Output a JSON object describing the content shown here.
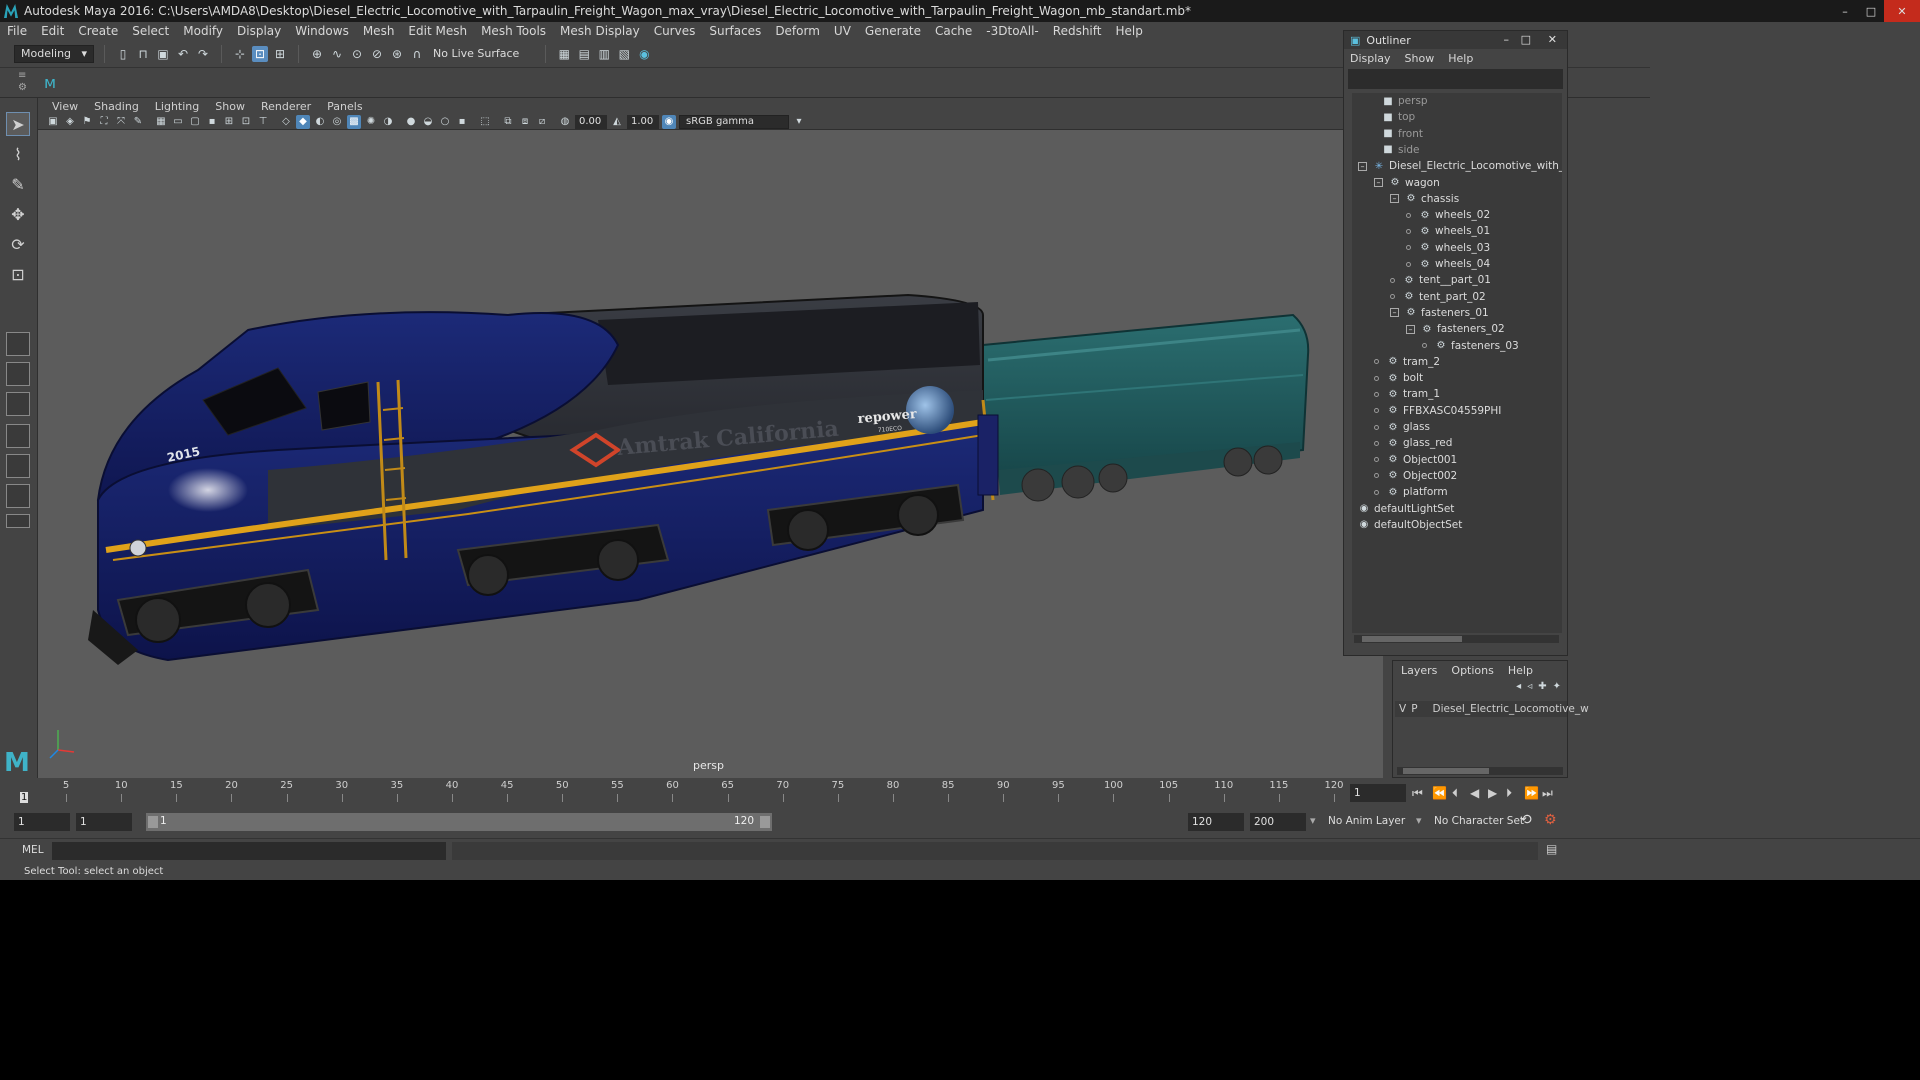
{
  "title_bar": {
    "title": "Autodesk Maya 2016: C:\\Users\\AMDA8\\Desktop\\Diesel_Electric_Locomotive_with_Tarpaulin_Freight_Wagon_max_vray\\Diesel_Electric_Locomotive_with_Tarpaulin_Freight_Wagon_mb_standart.mb*",
    "minimize": "–",
    "maximize": "□",
    "close": "✕"
  },
  "menubar": [
    "File",
    "Edit",
    "Create",
    "Select",
    "Modify",
    "Display",
    "Windows",
    "Mesh",
    "Edit Mesh",
    "Mesh Tools",
    "Mesh Display",
    "Curves",
    "Surfaces",
    "Deform",
    "UV",
    "Generate",
    "Cache",
    "-3DtoAll-",
    "Redshift",
    "Help"
  ],
  "toolbar": {
    "mode": "Modeling",
    "live_surface": "No Live Surface"
  },
  "viewport": {
    "menu": [
      "View",
      "Shading",
      "Lighting",
      "Show",
      "Renderer",
      "Panels"
    ],
    "exposure": "0.00",
    "gamma": "1.00",
    "color_space": "sRGB gamma",
    "camera_label": "persp",
    "loco_number": "2015",
    "loco_brand": "Amtrak California",
    "loco_badge": "repower",
    "loco_badge_sub": "710ECO"
  },
  "outliner": {
    "title": "Outliner",
    "menu": [
      "Display",
      "Show",
      "Help"
    ],
    "nodes": [
      {
        "label": "persp",
        "kind": "camera"
      },
      {
        "label": "top",
        "kind": "camera"
      },
      {
        "label": "front",
        "kind": "camera"
      },
      {
        "label": "side",
        "kind": "camera"
      },
      {
        "label": "Diesel_Electric_Locomotive_with_Tarpa",
        "kind": "root"
      },
      {
        "label": "wagon",
        "kind": "group"
      },
      {
        "label": "chassis",
        "kind": "group"
      },
      {
        "label": "wheels_02",
        "kind": "mesh"
      },
      {
        "label": "wheels_01",
        "kind": "mesh"
      },
      {
        "label": "wheels_03",
        "kind": "mesh"
      },
      {
        "label": "wheels_04",
        "kind": "mesh"
      },
      {
        "label": "tent__part_01",
        "kind": "mesh"
      },
      {
        "label": "tent_part_02",
        "kind": "mesh"
      },
      {
        "label": "fasteners_01",
        "kind": "group"
      },
      {
        "label": "fasteners_02",
        "kind": "group"
      },
      {
        "label": "fasteners_03",
        "kind": "mesh"
      },
      {
        "label": "tram_2",
        "kind": "mesh"
      },
      {
        "label": "bolt",
        "kind": "mesh"
      },
      {
        "label": "tram_1",
        "kind": "mesh"
      },
      {
        "label": "FFBXASC04559PHI",
        "kind": "mesh"
      },
      {
        "label": "glass",
        "kind": "mesh"
      },
      {
        "label": "glass_red",
        "kind": "mesh"
      },
      {
        "label": "Object001",
        "kind": "mesh"
      },
      {
        "label": "Object002",
        "kind": "mesh"
      },
      {
        "label": "platform",
        "kind": "mesh"
      },
      {
        "label": "defaultLightSet",
        "kind": "set"
      },
      {
        "label": "defaultObjectSet",
        "kind": "set"
      }
    ]
  },
  "layers": {
    "menu": [
      "Layers",
      "Options",
      "Help"
    ],
    "row": {
      "v": "V",
      "p": "P",
      "name": "Diesel_Electric_Locomotive_w",
      "color": "#a3283a"
    }
  },
  "timeline": {
    "tick_labels": [
      "5",
      "10",
      "15",
      "20",
      "25",
      "30",
      "35",
      "40",
      "45",
      "50",
      "55",
      "60",
      "65",
      "70",
      "75",
      "80",
      "85",
      "90",
      "95",
      "100",
      "105",
      "110",
      "115",
      "120"
    ],
    "current_frame": "1",
    "start_marker": "1"
  },
  "range": {
    "start": "1",
    "anim_start": "1",
    "range_start_label": "1",
    "range_end_label": "120",
    "end": "120",
    "anim_end": "200",
    "anim_layer": "No Anim Layer",
    "character_set": "No Character Set"
  },
  "command": {
    "label": "MEL"
  },
  "help_line": "Select Tool: select an object"
}
